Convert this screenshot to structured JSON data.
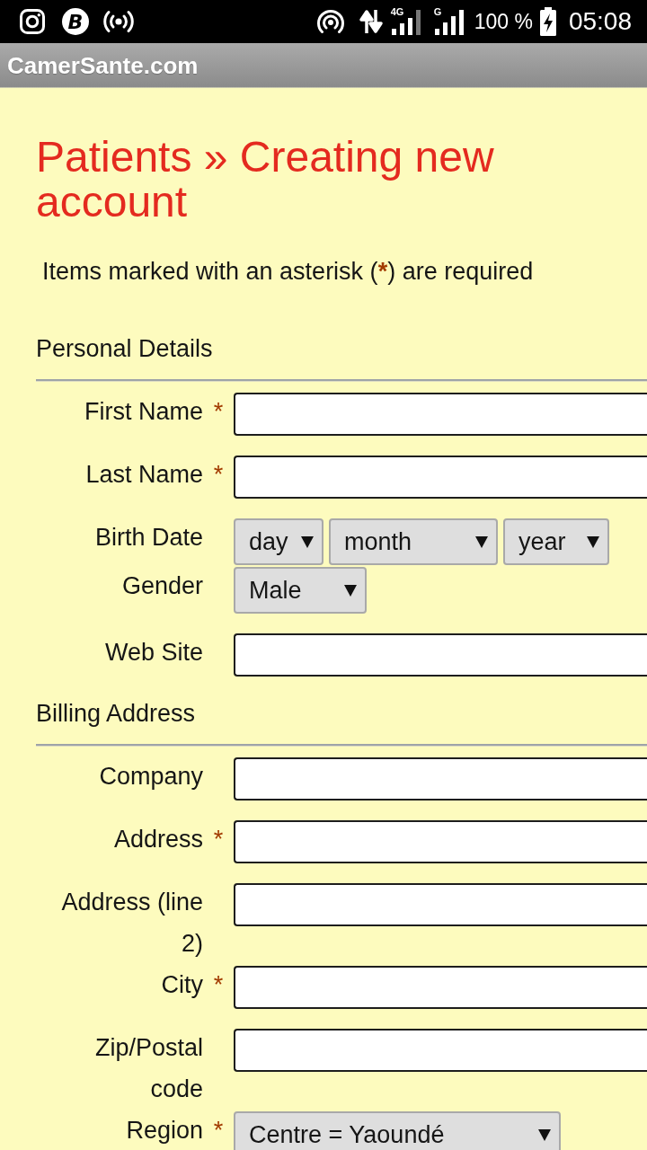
{
  "status_bar": {
    "badge_letter": "B",
    "signals": [
      {
        "label": "4G"
      },
      {
        "label": "G"
      }
    ],
    "battery": "100 %",
    "time": "05:08"
  },
  "browser_bar": {
    "title": "CamerSante.com"
  },
  "page": {
    "title": "Patients » Creating new account",
    "note": {
      "before": "Items marked with an asterisk (",
      "mark": "*",
      "after": ") are required"
    }
  },
  "sections": [
    {
      "heading": "Personal Details",
      "fields": [
        {
          "kind": "text",
          "label": "First Name",
          "asterisk": "*"
        },
        {
          "kind": "text",
          "label": "Last Name",
          "asterisk": "*"
        },
        {
          "kind": "select",
          "label": "Birth Date",
          "selects": [
            {
              "value": "day"
            },
            {
              "value": "month"
            },
            {
              "value": "year"
            }
          ]
        },
        {
          "kind": "select",
          "label": "Gender",
          "selects": [
            {
              "value": "Male"
            }
          ]
        },
        {
          "kind": "text",
          "label": "Web Site"
        }
      ]
    },
    {
      "heading": "Billing Address",
      "fields": [
        {
          "kind": "text",
          "label": "Company"
        },
        {
          "kind": "text",
          "label": "Address",
          "asterisk": "*"
        },
        {
          "kind": "text",
          "label": "Address (line 2)"
        },
        {
          "kind": "text",
          "label": "City",
          "asterisk": "*"
        },
        {
          "kind": "text",
          "label": "Zip/Postal code"
        },
        {
          "kind": "select",
          "label": "Region",
          "asterisk": "*",
          "selects": [
            {
              "value": "Centre = Yaoundé"
            }
          ]
        }
      ]
    }
  ]
}
